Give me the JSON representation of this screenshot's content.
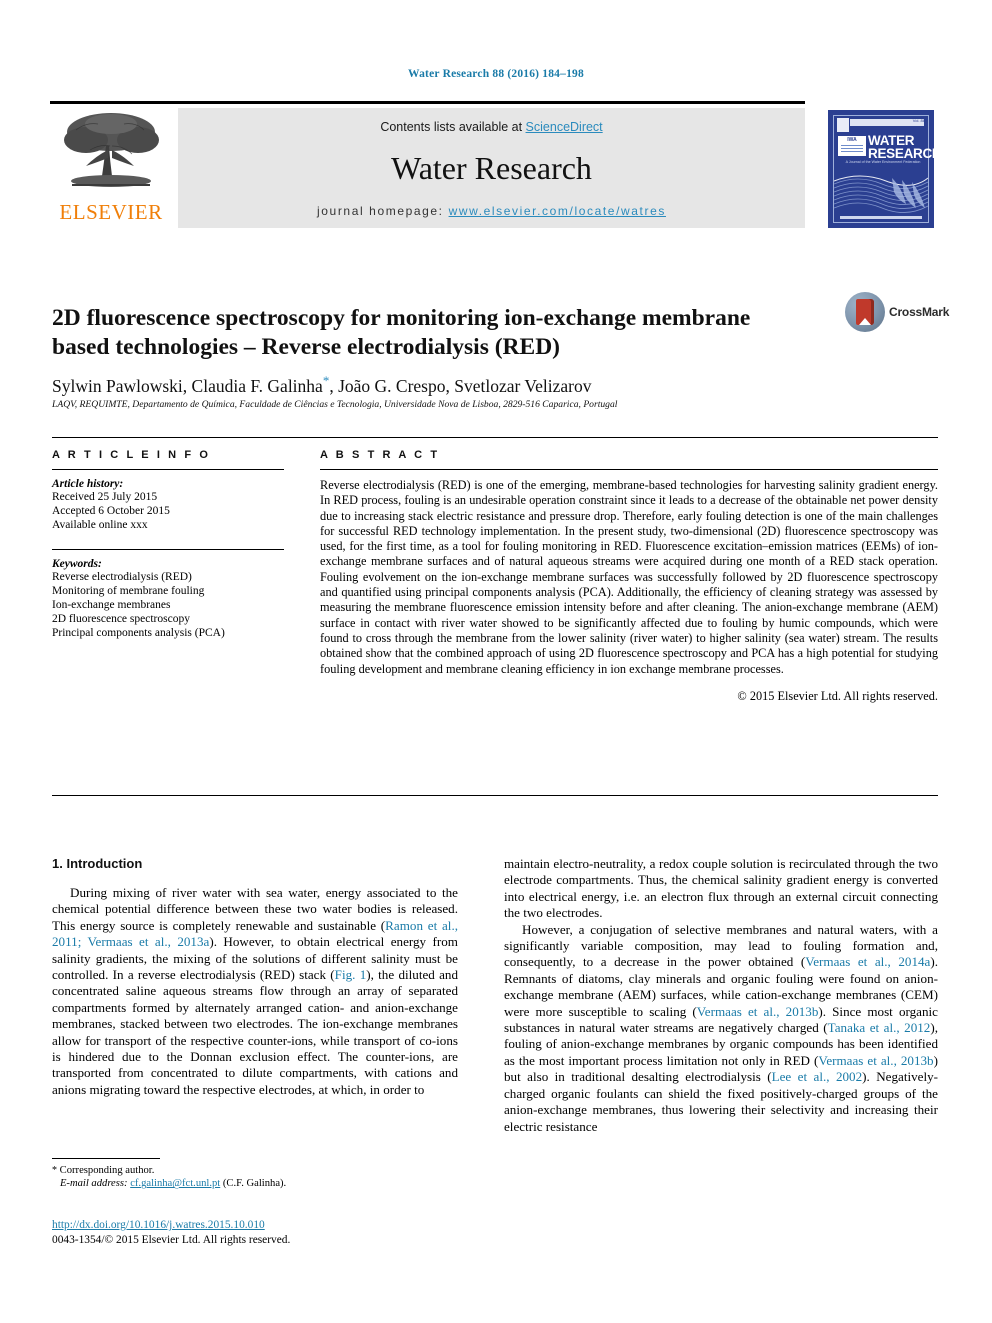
{
  "running_head": "Water Research 88 (2016) 184–198",
  "masthead": {
    "contents_prefix": "Contents lists available at ",
    "sciencedirect": "ScienceDirect",
    "journal_title": "Water Research",
    "homepage_prefix": "journal homepage: ",
    "homepage_url": "www.elsevier.com/locate/watres",
    "publisher": "ELSEVIER"
  },
  "cover": {
    "title_line1": "WATER",
    "title_line2": "RESEARCH",
    "badge": "IWA",
    "subtitle": "A Journal of the Water Environment Federation",
    "volume": "Vol. 88"
  },
  "article": {
    "title": "2D fluorescence spectroscopy for monitoring ion-exchange membrane based technologies – Reverse electrodialysis (RED)",
    "authors": "Sylwin Pawlowski, Claudia F. Galinha",
    "authors_tail": ", João G. Crespo, Svetlozar Velizarov",
    "corresponding_marker": "*",
    "affiliation": "LAQV, REQUIMTE, Departamento de Química, Faculdade de Ciências e Tecnologia, Universidade Nova de Lisboa, 2829-516 Caparica, Portugal",
    "crossmark_label": "CrossMark"
  },
  "article_info": {
    "heading": "A R T I C L E    I N F O",
    "history_label": "Article history:",
    "history": [
      "Received 25 July 2015",
      "Accepted 6 October 2015",
      "Available online xxx"
    ],
    "keywords_label": "Keywords:",
    "keywords": [
      "Reverse electrodialysis (RED)",
      "Monitoring of membrane fouling",
      "Ion-exchange membranes",
      "2D fluorescence spectroscopy",
      "Principal components analysis (PCA)"
    ]
  },
  "abstract": {
    "heading": "A B S T R A C T",
    "text": "Reverse electrodialysis (RED) is one of the emerging, membrane-based technologies for harvesting salinity gradient energy. In RED process, fouling is an undesirable operation constraint since it leads to a decrease of the obtainable net power density due to increasing stack electric resistance and pressure drop. Therefore, early fouling detection is one of the main challenges for successful RED technology implementation. In the present study, two-dimensional (2D) fluorescence spectroscopy was used, for the first time, as a tool for fouling monitoring in RED. Fluorescence excitation–emission matrices (EEMs) of ion-exchange membrane surfaces and of natural aqueous streams were acquired during one month of a RED stack operation. Fouling evolvement on the ion-exchange membrane surfaces was successfully followed by 2D fluorescence spectroscopy and quantified using principal components analysis (PCA). Additionally, the efficiency of cleaning strategy was assessed by measuring the membrane fluorescence emission intensity before and after cleaning. The anion-exchange membrane (AEM) surface in contact with river water showed to be significantly affected due to fouling by humic compounds, which were found to cross through the membrane from the lower salinity (river water) to higher salinity (sea water) stream. The results obtained show that the combined approach of using 2D fluorescence spectroscopy and PCA has a high potential for studying fouling development and membrane cleaning efficiency in ion exchange membrane processes.",
    "copyright": "© 2015 Elsevier Ltd. All rights reserved."
  },
  "body": {
    "section_heading": "1.  Introduction",
    "left_paragraph_1_a": "During mixing of river water with sea water, energy associated to the chemical potential difference between these two water bodies is released. This energy source is completely renewable and sustainable (",
    "left_cite_1": "Ramon et al., 2011; Vermaas et al., 2013a",
    "left_paragraph_1_b": "). However, to obtain electrical energy from salinity gradients, the mixing of the solutions of different salinity must be controlled. In a reverse electrodialysis (RED) stack (",
    "left_cite_2": "Fig. 1",
    "left_paragraph_1_c": "), the diluted and concentrated saline aqueous streams flow through an array of separated compartments formed by alternately arranged cation- and anion-exchange membranes, stacked between two electrodes. The ion-exchange membranes allow for transport of the respective counter-ions, while transport of co-ions is hindered due to the Donnan exclusion effect. The counter-ions, are transported from concentrated to dilute compartments, with cations and anions migrating toward the respective electrodes, at which, in order to",
    "right_paragraph_1": "maintain electro-neutrality, a redox couple solution is recirculated through the two electrode compartments. Thus, the chemical salinity gradient energy is converted into electrical energy, i.e. an electron flux through an external circuit connecting the two electrodes.",
    "right_paragraph_2_a": "However, a conjugation of selective membranes and natural waters, with a significantly variable composition, may lead to fouling formation and, consequently, to a decrease in the power obtained (",
    "right_cite_1": "Vermaas et al., 2014a",
    "right_paragraph_2_b": "). Remnants of diatoms, clay minerals and organic fouling were found on anion-exchange membrane (AEM) surfaces, while cation-exchange membranes (CEM) were more susceptible to scaling (",
    "right_cite_2": "Vermaas et al., 2013b",
    "right_paragraph_2_c": "). Since most organic substances in natural water streams are negatively charged (",
    "right_cite_3": "Tanaka et al., 2012",
    "right_paragraph_2_d": "), fouling of anion-exchange membranes by organic compounds has been identified as the most important process limitation not only in RED (",
    "right_cite_4": "Vermaas et al., 2013b",
    "right_paragraph_2_e": ") but also in traditional desalting electrodialysis (",
    "right_cite_5": "Lee et al., 2002",
    "right_paragraph_2_f": "). Negatively-charged organic foulants can shield the fixed positively-charged groups of the anion-exchange membranes, thus lowering their selectivity and increasing their electric resistance"
  },
  "footnote": {
    "marker": "*",
    "corresponding": " Corresponding author.",
    "email_label": "E-mail address:",
    "email": "cf.galinha@fct.unl.pt",
    "email_owner": "(C.F. Galinha).",
    "doi": "http://dx.doi.org/10.1016/j.watres.2015.10.010",
    "issn_line": "0043-1354/© 2015 Elsevier Ltd. All rights reserved."
  },
  "colors": {
    "link": "#1a7ba8",
    "sciencedirect": "#2b8bbd",
    "elsevier_orange": "#f07f09",
    "cover_blue": "#2b3f91"
  }
}
